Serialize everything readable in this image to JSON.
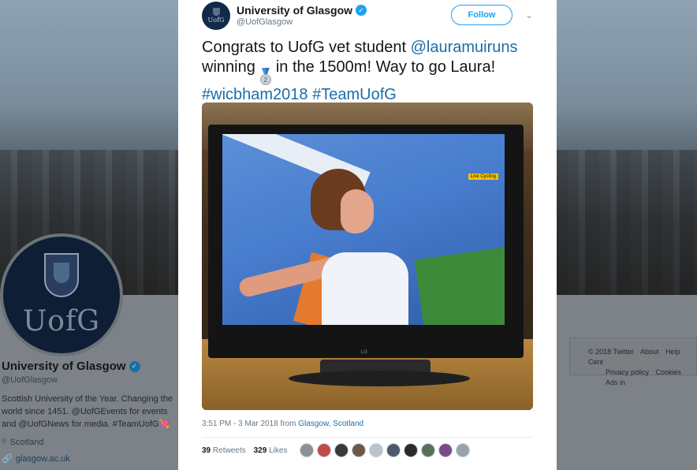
{
  "background_profile": {
    "name": "University of Glasgow",
    "handle": "@UofGlasgow",
    "bio": "Scottish University of the Year. Changing the world since 1451. @UofGEvents for events and @UofGNews for media. #TeamUofG💘",
    "location": "Scotland",
    "url": "glasgow.ac.uk",
    "logo_text": "UofG",
    "footer": {
      "copyright": "© 2018 Twitter",
      "about": "About",
      "help": "Help Cent",
      "privacy": "Privacy policy",
      "cookies": "Cookies",
      "ads": "Ads in"
    }
  },
  "tweet": {
    "author": {
      "name": "University of Glasgow",
      "handle": "@UofGlasgow",
      "avatar_text": "UofG",
      "verified": true
    },
    "follow_label": "Follow",
    "text_before_mention": "Congrats to UofG vet student ",
    "mention": "@lauramuiruns",
    "text_winning": "winning",
    "medal_number": "2",
    "text_after_medal": "in the 1500m! Way to go Laura!",
    "hashtag1": "#wicbham2018",
    "hashtag2": "#TeamUofG",
    "image": {
      "tv_brand": "LG",
      "live_tag": "Live Cycling"
    },
    "time": "3:51 PM - 3 Mar 2018 from ",
    "location_link": "Glasgow, Scotland",
    "retweets_count": "39",
    "retweets_label": "Retweets",
    "likes_count": "329",
    "likes_label": "Likes",
    "liker_colors": [
      "#8d8f91",
      "#c24a4a",
      "#3a3a3a",
      "#6b5a4a",
      "#b9c4cc",
      "#4a5a6a",
      "#2b2b2b",
      "#5a6f5a",
      "#7a4a8a",
      "#9aa3ab"
    ]
  },
  "colors": {
    "accent": "#1da1f2",
    "link": "#1b6da8",
    "uofg_navy": "#13294b"
  }
}
